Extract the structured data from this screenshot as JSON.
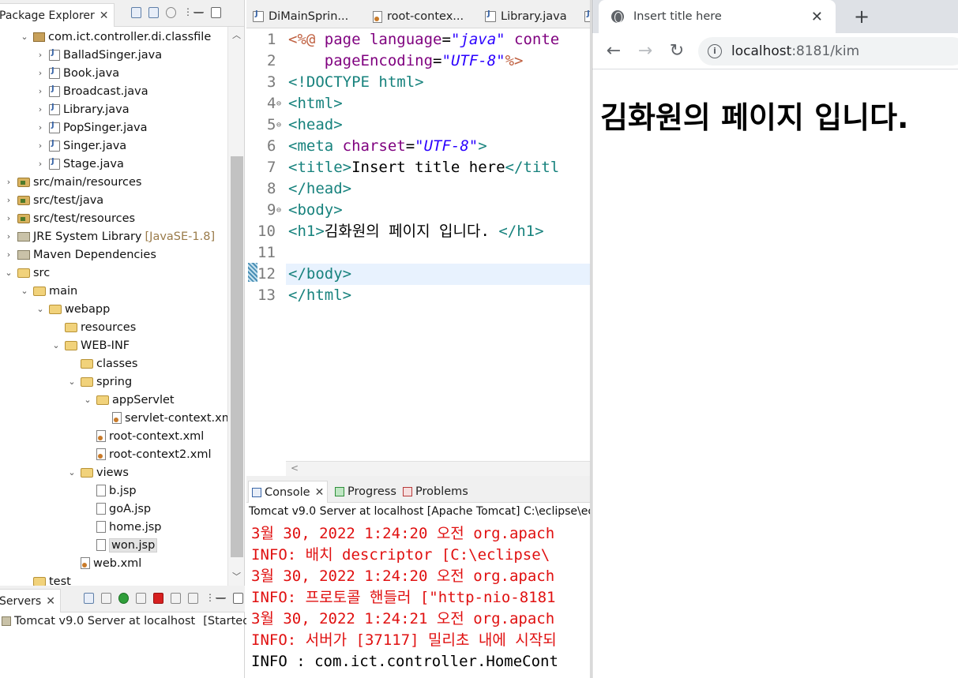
{
  "package_explorer": {
    "tab_label": "Package Explorer",
    "tree": [
      {
        "indent": 1,
        "twisty": "v",
        "icon": "pkg",
        "label": "com.ict.controller.di.classfile"
      },
      {
        "indent": 2,
        "twisty": ">",
        "icon": "java",
        "label": "BalladSinger.java"
      },
      {
        "indent": 2,
        "twisty": ">",
        "icon": "java",
        "label": "Book.java"
      },
      {
        "indent": 2,
        "twisty": ">",
        "icon": "java",
        "label": "Broadcast.java"
      },
      {
        "indent": 2,
        "twisty": ">",
        "icon": "java",
        "label": "Library.java"
      },
      {
        "indent": 2,
        "twisty": ">",
        "icon": "java",
        "label": "PopSinger.java"
      },
      {
        "indent": 2,
        "twisty": ">",
        "icon": "java",
        "label": "Singer.java"
      },
      {
        "indent": 2,
        "twisty": ">",
        "icon": "java",
        "label": "Stage.java"
      },
      {
        "indent": 0,
        "twisty": ">",
        "icon": "srcfolder",
        "label": "src/main/resources"
      },
      {
        "indent": 0,
        "twisty": ">",
        "icon": "srcfolder",
        "label": "src/test/java"
      },
      {
        "indent": 0,
        "twisty": ">",
        "icon": "srcfolder",
        "label": "src/test/resources"
      },
      {
        "indent": 0,
        "twisty": ">",
        "icon": "lib",
        "label": "JRE System Library",
        "sub": "[JavaSE-1.8]"
      },
      {
        "indent": 0,
        "twisty": ">",
        "icon": "lib",
        "label": "Maven Dependencies"
      },
      {
        "indent": 0,
        "twisty": "v",
        "icon": "folder",
        "label": "src"
      },
      {
        "indent": 1,
        "twisty": "v",
        "icon": "folder",
        "label": "main"
      },
      {
        "indent": 2,
        "twisty": "v",
        "icon": "folder",
        "label": "webapp"
      },
      {
        "indent": 3,
        "twisty": "",
        "icon": "folder",
        "label": "resources"
      },
      {
        "indent": 3,
        "twisty": "v",
        "icon": "folder",
        "label": "WEB-INF"
      },
      {
        "indent": 4,
        "twisty": "",
        "icon": "folder",
        "label": "classes"
      },
      {
        "indent": 4,
        "twisty": "v",
        "icon": "folder",
        "label": "spring"
      },
      {
        "indent": 5,
        "twisty": "v",
        "icon": "folder",
        "label": "appServlet"
      },
      {
        "indent": 6,
        "twisty": "",
        "icon": "xml",
        "label": "servlet-context.xml"
      },
      {
        "indent": 5,
        "twisty": "",
        "icon": "xml",
        "label": "root-context.xml"
      },
      {
        "indent": 5,
        "twisty": "",
        "icon": "xml",
        "label": "root-context2.xml"
      },
      {
        "indent": 4,
        "twisty": "v",
        "icon": "folder",
        "label": "views"
      },
      {
        "indent": 5,
        "twisty": "",
        "icon": "file",
        "label": "b.jsp"
      },
      {
        "indent": 5,
        "twisty": "",
        "icon": "file",
        "label": "goA.jsp"
      },
      {
        "indent": 5,
        "twisty": "",
        "icon": "file",
        "label": "home.jsp"
      },
      {
        "indent": 5,
        "twisty": "",
        "icon": "file",
        "label": "won.jsp",
        "selected": true
      },
      {
        "indent": 4,
        "twisty": "",
        "icon": "xml",
        "label": "web.xml"
      },
      {
        "indent": 1,
        "twisty": "",
        "icon": "folder",
        "label": "test"
      }
    ]
  },
  "servers": {
    "tab_label": "Servers",
    "row_label": "Tomcat v9.0 Server at localhost",
    "row_status": "[Started, S"
  },
  "editor": {
    "tabs": [
      "DiMainSprin...",
      "root-contex...",
      "Library.java"
    ],
    "lines": [
      {
        "n": "1",
        "fold": "",
        "segs": [
          [
            "jsp",
            "<%@ "
          ],
          [
            "attr",
            "page "
          ],
          [
            "attr",
            "language"
          ],
          [
            "txt",
            "="
          ],
          [
            "val",
            "\"java\""
          ],
          [
            "txt",
            " "
          ],
          [
            "attr",
            "conte"
          ]
        ]
      },
      {
        "n": "2",
        "fold": "",
        "segs": [
          [
            "txt",
            "    "
          ],
          [
            "attr",
            "pageEncoding"
          ],
          [
            "txt",
            "="
          ],
          [
            "val",
            "\"UTF-8\""
          ],
          [
            "jsp",
            "%>"
          ]
        ]
      },
      {
        "n": "3",
        "fold": "",
        "segs": [
          [
            "tag",
            "<!DOCTYPE html>"
          ]
        ]
      },
      {
        "n": "4",
        "fold": "⊖",
        "segs": [
          [
            "tag",
            "<html>"
          ]
        ]
      },
      {
        "n": "5",
        "fold": "⊖",
        "segs": [
          [
            "tag",
            "<head>"
          ]
        ]
      },
      {
        "n": "6",
        "fold": "",
        "segs": [
          [
            "tag",
            "<meta "
          ],
          [
            "attr",
            "charset"
          ],
          [
            "txt",
            "="
          ],
          [
            "val",
            "\"UTF-8\""
          ],
          [
            "tag",
            ">"
          ]
        ]
      },
      {
        "n": "7",
        "fold": "",
        "segs": [
          [
            "tag",
            "<title>"
          ],
          [
            "txt",
            "Insert title here"
          ],
          [
            "tag",
            "</titl"
          ]
        ]
      },
      {
        "n": "8",
        "fold": "",
        "segs": [
          [
            "tag",
            "</head>"
          ]
        ]
      },
      {
        "n": "9",
        "fold": "⊖",
        "segs": [
          [
            "tag",
            "<body>"
          ]
        ]
      },
      {
        "n": "10",
        "fold": "",
        "segs": [
          [
            "tag",
            "<h1>"
          ],
          [
            "txt",
            "김화원의 페이지 입니다. "
          ],
          [
            "tag",
            "</h1>"
          ]
        ]
      },
      {
        "n": "11",
        "fold": "",
        "segs": []
      },
      {
        "n": "12",
        "fold": "",
        "segs": [
          [
            "tag",
            "</body>"
          ]
        ],
        "highlight": true
      },
      {
        "n": "13",
        "fold": "",
        "segs": [
          [
            "tag",
            "</html>"
          ]
        ]
      }
    ]
  },
  "console": {
    "tabs": [
      "Console",
      "Progress",
      "Problems"
    ],
    "header": "Tomcat v9.0 Server at localhost [Apache Tomcat] C:\\eclipse\\ec",
    "lines": [
      {
        "color": "red",
        "text": "3월 30, 2022 1:24:20 오전 org.apach"
      },
      {
        "color": "red",
        "text": "INFO: 배치 descriptor [C:\\eclipse\\"
      },
      {
        "color": "red",
        "text": "3월 30, 2022 1:24:20 오전 org.apach"
      },
      {
        "color": "red",
        "text": "INFO: 프로토콜 핸들러 [\"http-nio-8181"
      },
      {
        "color": "red",
        "text": "3월 30, 2022 1:24:21 오전 org.apach"
      },
      {
        "color": "red",
        "text": "INFO: 서버가 [37117] 밀리초 내에 시작되"
      },
      {
        "color": "black",
        "text": "INFO : com.ict.controller.HomeCont"
      }
    ]
  },
  "browser": {
    "tab_title": "Insert title here",
    "close": "✕",
    "new_tab": "+",
    "url_host": "localhost",
    "url_path": ":8181/kim",
    "page_heading": "김화원의 페이지 입니다."
  }
}
